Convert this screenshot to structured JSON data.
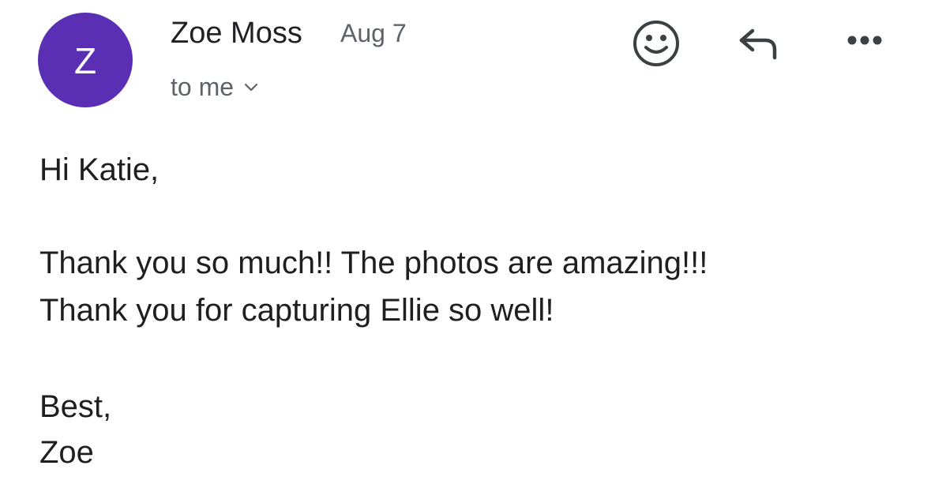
{
  "sender": {
    "avatar_letter": "Z",
    "avatar_color": "#5a2fb4",
    "name": "Zoe Moss",
    "date": "Aug 7",
    "recipient_label": "to me"
  },
  "actions": {
    "emoji_icon": "smiley-icon",
    "reply_icon": "reply-icon",
    "more_icon": "more-options-icon"
  },
  "message": {
    "greeting": "Hi Katie,",
    "lines": [
      "Thank you so much!! The photos are amazing!!!",
      "Thank you for capturing Ellie so well!"
    ],
    "signoff": "Best,",
    "signature": "Zoe"
  }
}
